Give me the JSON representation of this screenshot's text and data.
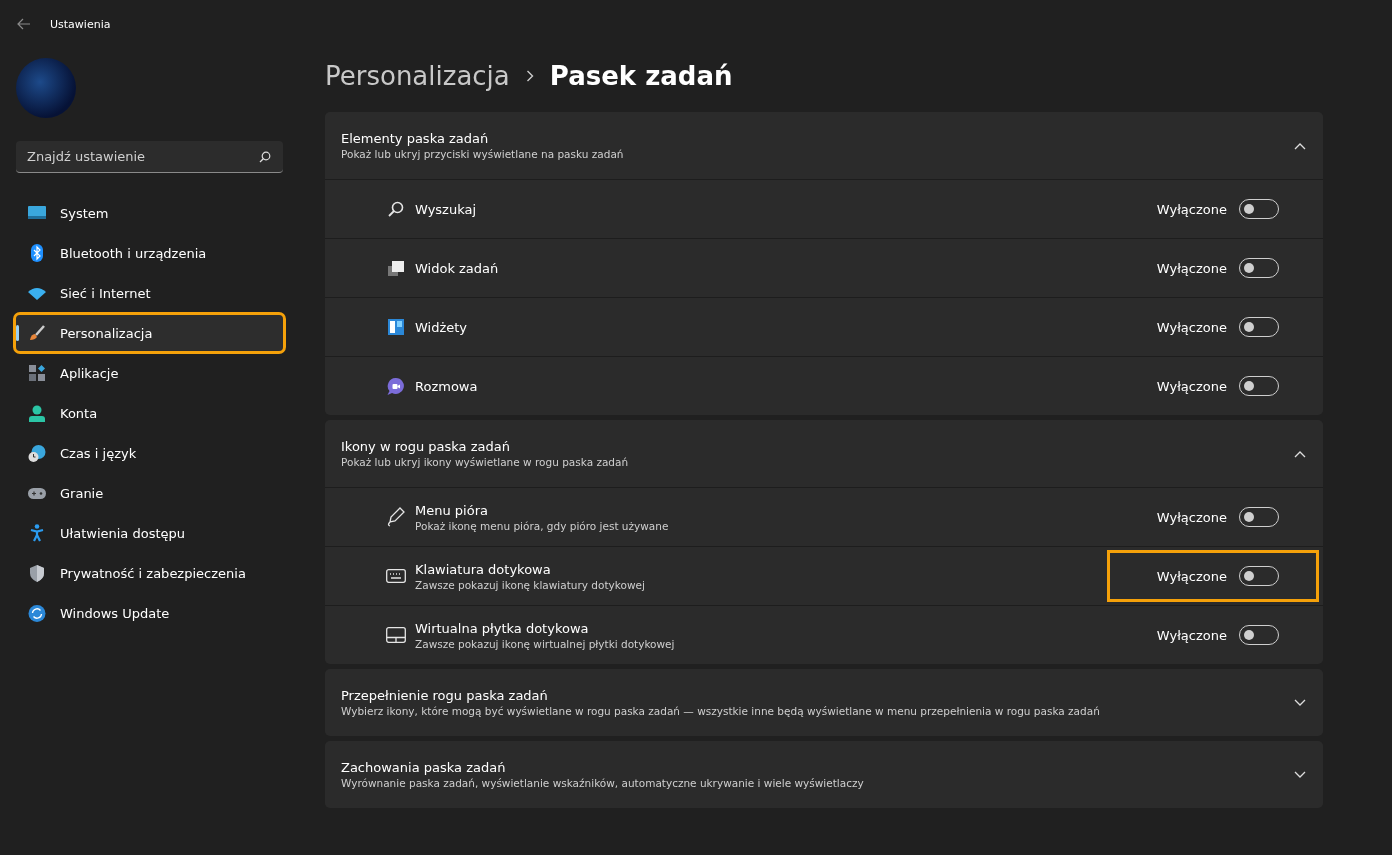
{
  "window": {
    "title": "Ustawienia"
  },
  "sidebar": {
    "search": {
      "placeholder": "Znajdź ustawienie"
    },
    "items": [
      {
        "label": "System",
        "kind": "system",
        "selected": false,
        "highlighted": false
      },
      {
        "label": "Bluetooth i urządzenia",
        "kind": "bluetooth",
        "selected": false,
        "highlighted": false
      },
      {
        "label": "Sieć i Internet",
        "kind": "wifi",
        "selected": false,
        "highlighted": false
      },
      {
        "label": "Personalizacja",
        "kind": "brush",
        "selected": true,
        "highlighted": true
      },
      {
        "label": "Aplikacje",
        "kind": "apps",
        "selected": false,
        "highlighted": false
      },
      {
        "label": "Konta",
        "kind": "person",
        "selected": false,
        "highlighted": false
      },
      {
        "label": "Czas i język",
        "kind": "globe",
        "selected": false,
        "highlighted": false
      },
      {
        "label": "Granie",
        "kind": "gamepad",
        "selected": false,
        "highlighted": false
      },
      {
        "label": "Ułatwienia dostępu",
        "kind": "accessibility",
        "selected": false,
        "highlighted": false
      },
      {
        "label": "Prywatność i zabezpieczenia",
        "kind": "shield",
        "selected": false,
        "highlighted": false
      },
      {
        "label": "Windows Update",
        "kind": "update",
        "selected": false,
        "highlighted": false
      }
    ]
  },
  "breadcrumb": [
    "Personalizacja",
    "Pasek zadań"
  ],
  "sections": [
    {
      "title": "Elementy paska zadań",
      "subtitle": "Pokaż lub ukryj przyciski wyświetlane na pasku zadań",
      "expanded": true,
      "items": [
        {
          "label": "Wyszukaj",
          "kind": "search",
          "state_text": "Wyłączone",
          "on": false,
          "highlighted": false
        },
        {
          "label": "Widok zadań",
          "kind": "taskview",
          "state_text": "Wyłączone",
          "on": false,
          "highlighted": false
        },
        {
          "label": "Widżety",
          "kind": "widgets",
          "state_text": "Wyłączone",
          "on": false,
          "highlighted": false
        },
        {
          "label": "Rozmowa",
          "kind": "chat",
          "state_text": "Wyłączone",
          "on": false,
          "highlighted": false
        }
      ]
    },
    {
      "title": "Ikony w rogu paska zadań",
      "subtitle": "Pokaż lub ukryj ikony wyświetlane w rogu paska zadań",
      "expanded": true,
      "items": [
        {
          "label": "Menu pióra",
          "description": "Pokaż ikonę menu pióra, gdy pióro jest używane",
          "kind": "pen",
          "state_text": "Wyłączone",
          "on": false,
          "highlighted": false
        },
        {
          "label": "Klawiatura dotykowa",
          "description": "Zawsze pokazuj ikonę klawiatury dotykowej",
          "kind": "keyboard",
          "state_text": "Wyłączone",
          "on": false,
          "highlighted": true
        },
        {
          "label": "Wirtualna płytka dotykowa",
          "description": "Zawsze pokazuj ikonę wirtualnej płytki dotykowej",
          "kind": "touchpad",
          "state_text": "Wyłączone",
          "on": false,
          "highlighted": false
        }
      ]
    },
    {
      "title": "Przepełnienie rogu paska zadań",
      "subtitle": "Wybierz ikony, które mogą być wyświetlane w rogu paska zadań — wszystkie inne będą wyświetlane w menu przepełnienia w rogu paska zadań",
      "expanded": false
    },
    {
      "title": "Zachowania paska zadań",
      "subtitle": "Wyrównanie paska zadań, wyświetlanie wskaźników, automatyczne ukrywanie i wiele wyświetlaczy",
      "expanded": false
    }
  ]
}
